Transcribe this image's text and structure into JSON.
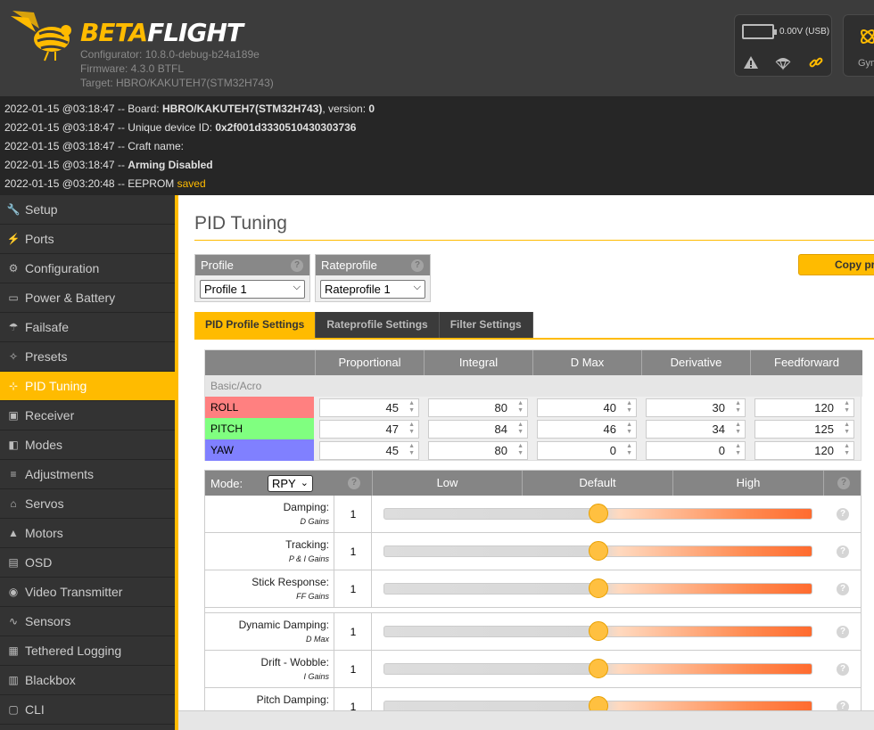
{
  "header": {
    "logo_text_a": "BETA",
    "logo_text_b": "FLIGHT",
    "configurator": "Configurator: 10.8.0-debug-b24a189e",
    "firmware": "Firmware: 4.3.0 BTFL",
    "target": "Target: HBRO/KAKUTEH7(STM32H743)",
    "battery_text": "0.00V (USB)",
    "gym_label": "Gym"
  },
  "log": [
    {
      "prefix": "2022-01-15 @03:18:47 -- Board: ",
      "bold": "HBRO/KAKUTEH7(STM32H743)",
      "mid": ", version: ",
      "bold2": "0",
      "accent": ""
    },
    {
      "prefix": "2022-01-15 @03:18:47 -- Unique device ID: ",
      "bold": "0x2f001d3330510430303736",
      "mid": "",
      "bold2": "",
      "accent": ""
    },
    {
      "prefix": "2022-01-15 @03:18:47 -- Craft name: ",
      "bold": "",
      "mid": "",
      "bold2": "",
      "accent": ""
    },
    {
      "prefix": "2022-01-15 @03:18:47 -- ",
      "bold": "Arming Disabled",
      "mid": "",
      "bold2": "",
      "accent": ""
    },
    {
      "prefix": "2022-01-15 @03:20:48 -- EEPROM ",
      "bold": "",
      "mid": "",
      "bold2": "",
      "accent": "saved"
    }
  ],
  "sidebar": {
    "items": [
      {
        "label": "Setup",
        "icon": "wrench-icon"
      },
      {
        "label": "Ports",
        "icon": "plug-icon"
      },
      {
        "label": "Configuration",
        "icon": "gear-icon"
      },
      {
        "label": "Power & Battery",
        "icon": "battery-icon"
      },
      {
        "label": "Failsafe",
        "icon": "parachute-icon"
      },
      {
        "label": "Presets",
        "icon": "wand-icon"
      },
      {
        "label": "PID Tuning",
        "icon": "pid-icon"
      },
      {
        "label": "Receiver",
        "icon": "receiver-icon"
      },
      {
        "label": "Modes",
        "icon": "toggle-icon"
      },
      {
        "label": "Adjustments",
        "icon": "sliders-icon"
      },
      {
        "label": "Servos",
        "icon": "servo-icon"
      },
      {
        "label": "Motors",
        "icon": "motor-icon"
      },
      {
        "label": "OSD",
        "icon": "osd-icon"
      },
      {
        "label": "Video Transmitter",
        "icon": "broadcast-icon"
      },
      {
        "label": "Sensors",
        "icon": "pulse-icon"
      },
      {
        "label": "Tethered Logging",
        "icon": "log-icon"
      },
      {
        "label": "Blackbox",
        "icon": "blackbox-icon"
      },
      {
        "label": "CLI",
        "icon": "terminal-icon"
      }
    ],
    "active": "PID Tuning"
  },
  "main": {
    "title": "PID Tuning",
    "profile_label": "Profile",
    "profile_value": "Profile 1",
    "rateprofile_label": "Rateprofile",
    "rateprofile_value": "Rateprofile 1",
    "copy_button": "Copy pr",
    "tabs": [
      "PID Profile Settings",
      "Rateprofile Settings",
      "Filter Settings"
    ],
    "active_tab": "PID Profile Settings",
    "pid_columns": [
      "Proportional",
      "Integral",
      "D Max",
      "Derivative",
      "Feedforward"
    ],
    "group_label": "Basic/Acro",
    "pid_rows": [
      {
        "axis": "ROLL",
        "color": "#ff8080",
        "values": [
          "45",
          "80",
          "40",
          "30",
          "120"
        ]
      },
      {
        "axis": "PITCH",
        "color": "#80ff80",
        "values": [
          "47",
          "84",
          "46",
          "34",
          "125"
        ]
      },
      {
        "axis": "YAW",
        "color": "#8080ff",
        "values": [
          "45",
          "80",
          "0",
          "0",
          "120"
        ]
      }
    ],
    "slider_header": {
      "mode_label": "Mode:",
      "mode_value": "RPY",
      "low": "Low",
      "default": "Default",
      "high": "High"
    },
    "sliders": [
      {
        "name": "Damping:",
        "sub": "D Gains",
        "value": "1",
        "level": 0.5
      },
      {
        "name": "Tracking:",
        "sub": "P & I Gains",
        "value": "1",
        "level": 0.5
      },
      {
        "name": "Stick Response:",
        "sub": "FF Gains",
        "value": "1",
        "level": 0.5
      },
      {
        "name": "Dynamic Damping:",
        "sub": "D Max",
        "value": "1",
        "level": 0.5
      },
      {
        "name": "Drift - Wobble:",
        "sub": "I Gains",
        "value": "1",
        "level": 0.5
      },
      {
        "name": "Pitch Damping:",
        "sub": "",
        "value": "1",
        "level": 0.5
      }
    ],
    "help_glyph": "?"
  }
}
